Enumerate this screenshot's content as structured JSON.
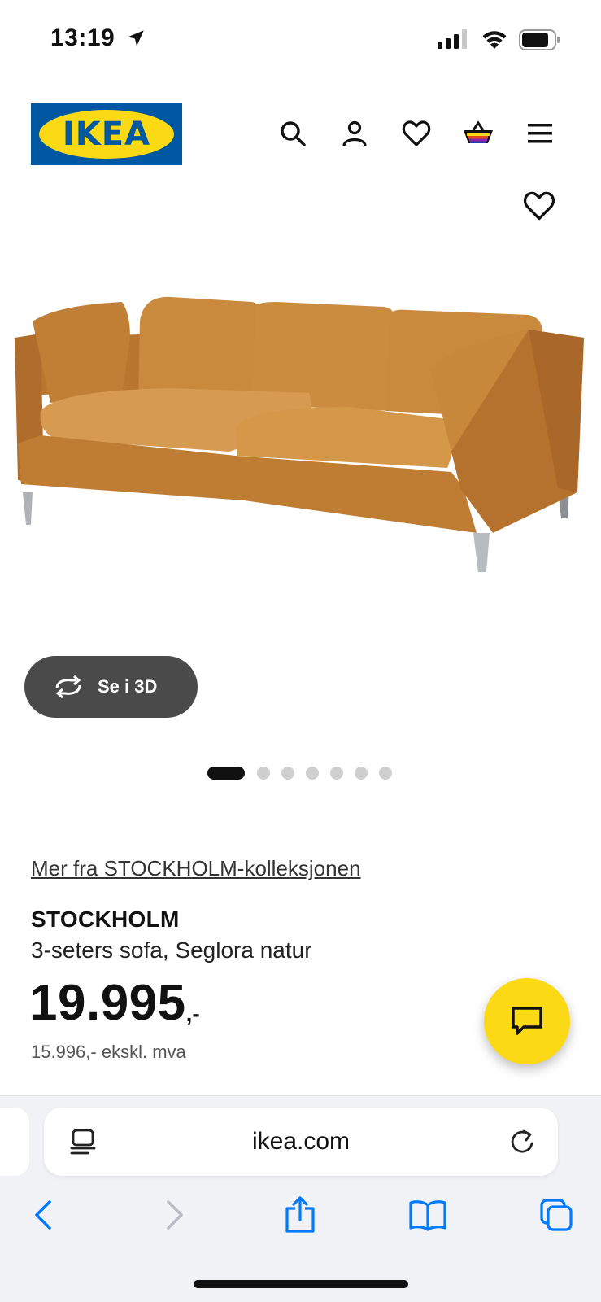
{
  "status_bar": {
    "time": "13:19"
  },
  "header": {
    "logo_text": "IKEA",
    "icons": [
      "search-icon",
      "account-icon",
      "heart-icon",
      "basket-icon",
      "menu-icon"
    ]
  },
  "media": {
    "view_3d_label": "Se i 3D",
    "pager": {
      "total": 7,
      "active": 1
    }
  },
  "product": {
    "collection_link": "Mer fra STOCKHOLM-kolleksjonen",
    "name": "STOCKHOLM",
    "description": "3-seters sofa, Seglora natur",
    "price": "19.995",
    "price_suffix": ",-",
    "price_ex_vat": "15.996,- ekskl. mva"
  },
  "browser": {
    "url": "ikea.com",
    "nav": [
      "back-icon",
      "forward-icon",
      "share-icon",
      "bookmarks-icon",
      "tabs-icon"
    ]
  },
  "colors": {
    "ikea_blue": "#0058a3",
    "ikea_yellow": "#fbd914",
    "ios_blue": "#007aff"
  }
}
